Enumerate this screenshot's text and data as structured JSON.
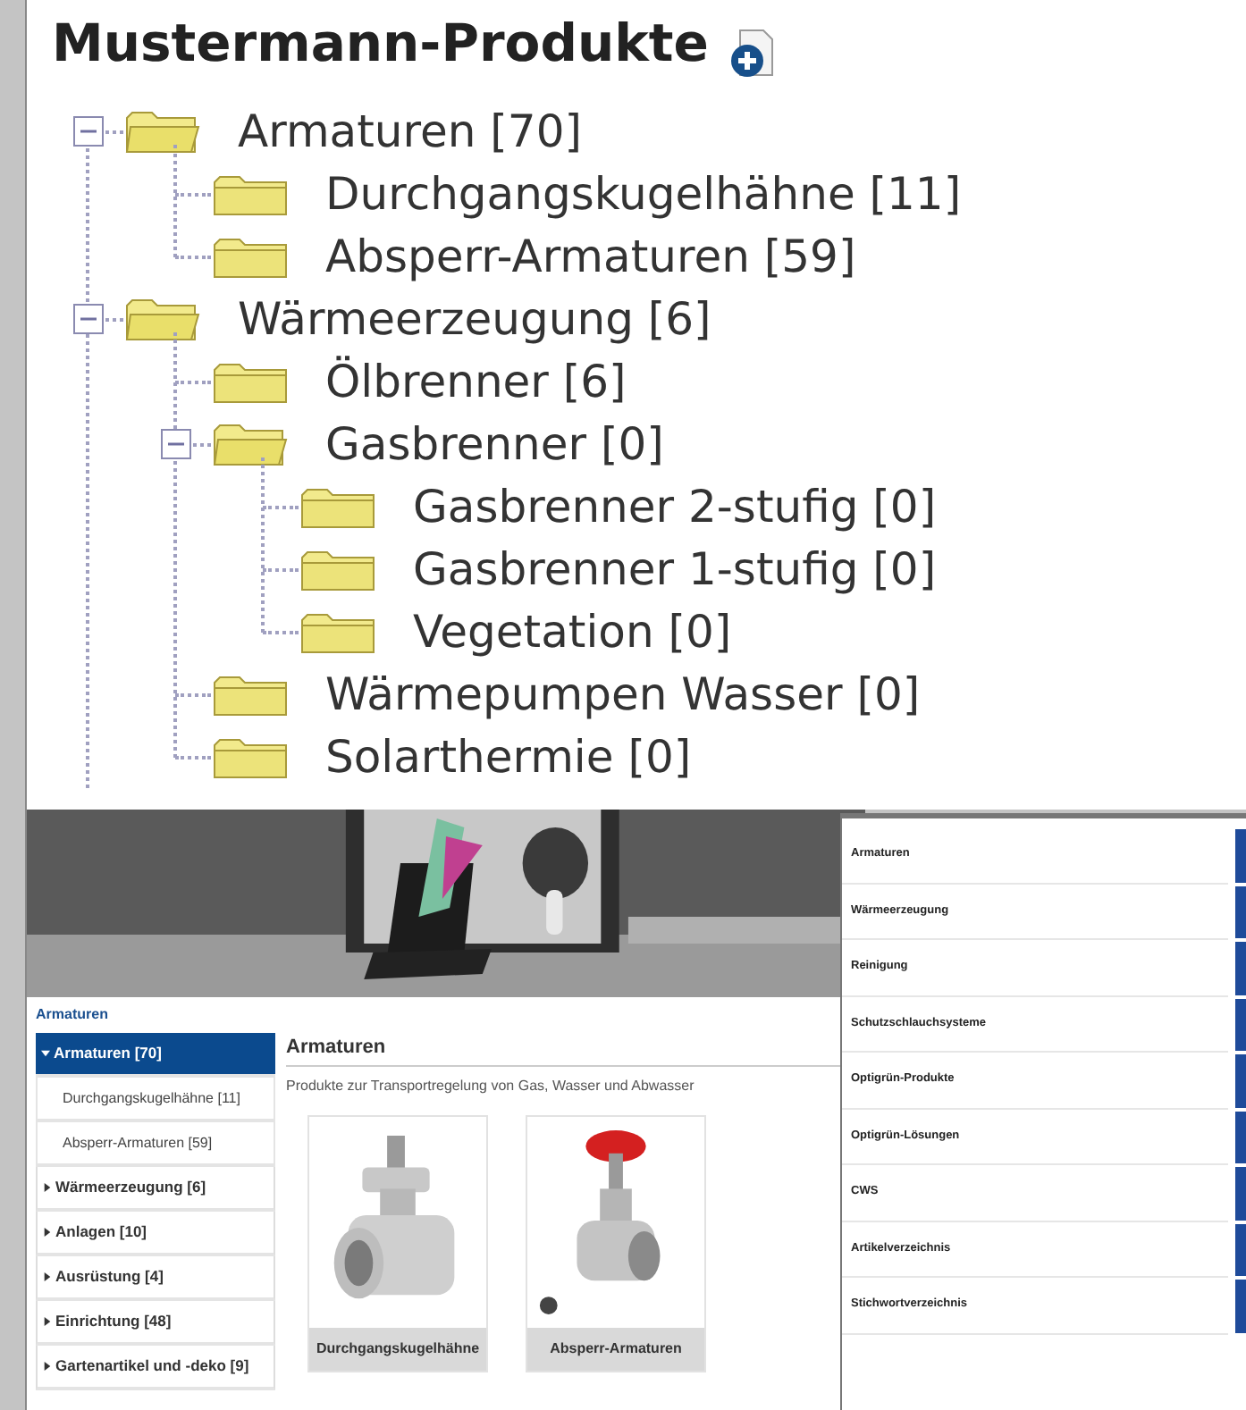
{
  "tree": {
    "title": "Mustermann-Produkte",
    "nodes": [
      {
        "label": "Armaturen [70]",
        "expanded": true,
        "children": [
          {
            "label": "Durchgangskugelhähne [11]"
          },
          {
            "label": "Absperr-Armaturen [59]"
          }
        ]
      },
      {
        "label": "Wärmeerzeugung [6]",
        "expanded": true,
        "children": [
          {
            "label": "Ölbrenner [6]"
          },
          {
            "label": "Gasbrenner [0]",
            "expanded": true,
            "children": [
              {
                "label": "Gasbrenner 2-stufig [0]"
              },
              {
                "label": "Gasbrenner 1-stufig [0]"
              },
              {
                "label": "Vegetation [0]"
              }
            ]
          },
          {
            "label": "Wärmepumpen Wasser [0]"
          },
          {
            "label": "Solarthermie [0]"
          }
        ]
      }
    ]
  },
  "shop": {
    "breadcrumb": "Armaturen",
    "sidebar": [
      {
        "label": "Armaturen [70]",
        "selected": true,
        "expanded": true,
        "children": [
          {
            "label": "Durchgangskugelhähne [11]",
            "selected": false
          },
          {
            "label": "Absperr-Armaturen [59]",
            "selected": false
          }
        ]
      },
      {
        "label": "Wärmeerzeugung [6]",
        "selected": false,
        "expanded": false
      },
      {
        "label": "Anlagen [10]",
        "selected": false,
        "expanded": false
      },
      {
        "label": "Ausrüstung [4]",
        "selected": false,
        "expanded": false
      },
      {
        "label": "Einrichtung [48]",
        "selected": false,
        "expanded": false
      },
      {
        "label": "Gartenartikel und -deko [9]",
        "selected": false,
        "expanded": false
      }
    ],
    "heading": "Armaturen",
    "description": "Produkte zur Transportregelung von Gas, Wasser und Abwasser",
    "products": [
      {
        "name": "Durchgangskugelhähne"
      },
      {
        "name": "Absperr-Armaturen"
      }
    ]
  },
  "menu": {
    "items": [
      "Armaturen",
      "Wärmeerzeugung",
      "Reinigung",
      "Schutzschlauchsysteme",
      "Optigrün-Produkte",
      "Optigrün-Lösungen",
      "CWS",
      "Artikelverzeichnis",
      "Stichwortverzeichnis"
    ]
  }
}
